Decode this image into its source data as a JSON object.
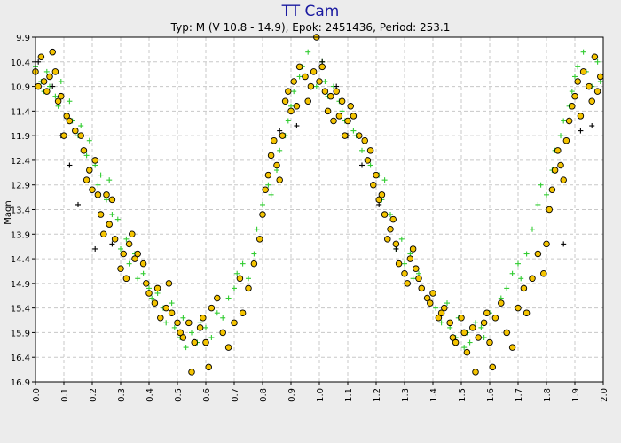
{
  "chart_data": {
    "type": "scatter",
    "title": "TT Cam",
    "subtitle": "Typ: M (V 10.8 - 14.9), Epok: 2451436, Period: 253.1",
    "xlabel": "",
    "ylabel": "Magn",
    "xlim": [
      0.0,
      2.0
    ],
    "ylim": [
      9.9,
      16.9
    ],
    "y_inverted": true,
    "x_ticks": [
      "0.0",
      "0.1",
      "0.2",
      "0.3",
      "0.4",
      "0.5",
      "0.6",
      "0.7",
      "0.8",
      "0.9",
      "1.0",
      "1.1",
      "1.2",
      "1.3",
      "1.4",
      "1.5",
      "1.6",
      "1.7",
      "1.8",
      "1.9",
      "2.0"
    ],
    "y_ticks": [
      "9.9",
      "10.4",
      "10.9",
      "11.4",
      "11.9",
      "12.4",
      "12.9",
      "13.4",
      "13.9",
      "14.4",
      "14.9",
      "15.4",
      "15.9",
      "16.4",
      "16.9"
    ],
    "grid": true,
    "legend": "none",
    "series": [
      {
        "marker": "circle",
        "color": "#f5c400",
        "x": [
          0.0,
          0.01,
          0.02,
          0.03,
          0.04,
          0.05,
          0.06,
          0.07,
          0.08,
          0.09,
          0.1,
          0.11,
          0.12,
          0.14,
          0.16,
          0.17,
          0.18,
          0.19,
          0.2,
          0.21,
          0.22,
          0.23,
          0.24,
          0.25,
          0.26,
          0.27,
          0.28,
          0.3,
          0.31,
          0.32,
          0.33,
          0.34,
          0.35,
          0.36,
          0.38,
          0.39,
          0.4,
          0.42,
          0.43,
          0.44,
          0.46,
          0.47,
          0.48,
          0.5,
          0.51,
          0.52,
          0.54,
          0.55,
          0.56,
          0.58,
          0.59,
          0.6,
          0.61,
          0.62,
          0.64,
          0.66,
          0.68,
          0.7,
          0.72,
          0.73,
          0.75,
          0.77,
          0.79,
          0.8,
          0.81,
          0.82,
          0.83,
          0.84,
          0.85,
          0.86,
          0.87,
          0.88,
          0.89,
          0.9,
          0.91,
          0.92,
          0.93,
          0.95,
          0.96,
          0.97,
          0.98,
          0.99,
          1.0,
          1.01,
          1.02,
          1.03,
          1.04,
          1.05,
          1.06,
          1.07,
          1.08,
          1.09,
          1.1,
          1.11,
          1.12,
          1.14,
          1.16,
          1.17,
          1.18,
          1.19,
          1.2,
          1.21,
          1.22,
          1.23,
          1.24,
          1.25,
          1.26,
          1.27,
          1.28,
          1.3,
          1.31,
          1.32,
          1.33,
          1.34,
          1.35,
          1.36,
          1.38,
          1.39,
          1.4,
          1.42,
          1.43,
          1.44,
          1.46,
          1.47,
          1.48,
          1.5,
          1.51,
          1.52,
          1.54,
          1.55,
          1.56,
          1.58,
          1.59,
          1.6,
          1.61,
          1.62,
          1.64,
          1.66,
          1.68,
          1.7,
          1.72,
          1.73,
          1.75,
          1.77,
          1.79,
          1.8,
          1.81,
          1.82,
          1.83,
          1.84,
          1.85,
          1.86,
          1.87,
          1.88,
          1.89,
          1.9,
          1.91,
          1.92,
          1.93,
          1.95,
          1.96,
          1.97,
          1.98,
          1.99
        ],
        "y": [
          10.6,
          10.9,
          10.3,
          10.8,
          11.0,
          10.7,
          10.2,
          10.6,
          11.2,
          11.1,
          11.9,
          11.5,
          11.6,
          11.8,
          11.9,
          12.2,
          12.8,
          12.6,
          13.0,
          12.4,
          13.1,
          13.5,
          13.9,
          13.1,
          13.7,
          13.2,
          14.0,
          14.6,
          14.3,
          14.8,
          14.1,
          13.9,
          14.4,
          14.3,
          14.5,
          14.9,
          15.1,
          15.3,
          15.0,
          15.6,
          15.4,
          14.9,
          15.5,
          15.7,
          15.9,
          16.0,
          15.7,
          16.7,
          16.1,
          15.8,
          15.6,
          16.1,
          16.6,
          15.4,
          15.2,
          15.9,
          16.2,
          15.7,
          14.8,
          15.5,
          15.0,
          14.5,
          14.0,
          13.5,
          13.0,
          12.7,
          12.3,
          12.0,
          12.5,
          12.8,
          11.9,
          11.2,
          11.0,
          11.4,
          10.8,
          11.3,
          10.5,
          10.7,
          11.2,
          10.9,
          10.6,
          9.9,
          10.8,
          10.5,
          11.0,
          11.4,
          11.1,
          11.6,
          11.0,
          11.5,
          11.2,
          11.9,
          11.6,
          11.3,
          11.5,
          11.9,
          12.0,
          12.4,
          12.2,
          12.9,
          12.7,
          13.2,
          13.1,
          13.5,
          14.0,
          13.8,
          13.6,
          14.1,
          14.5,
          14.7,
          14.9,
          14.4,
          14.2,
          14.6,
          14.8,
          15.0,
          15.2,
          15.3,
          15.1,
          15.6,
          15.5,
          15.4,
          15.7,
          16.0,
          16.1,
          15.6,
          15.9,
          16.3,
          15.8,
          16.7,
          16.0,
          15.7,
          15.5,
          16.1,
          16.6,
          15.6,
          15.3,
          15.9,
          16.2,
          15.4,
          15.0,
          15.5,
          14.8,
          14.3,
          14.7,
          14.1,
          13.4,
          13.0,
          12.6,
          12.2,
          12.5,
          12.8,
          12.0,
          11.6,
          11.3,
          11.1,
          10.8,
          11.5,
          10.6,
          10.9,
          11.2,
          10.3,
          11.0,
          10.7
        ]
      },
      {
        "marker": "plus",
        "color": "#33cc33",
        "x": [
          0.0,
          0.02,
          0.03,
          0.04,
          0.05,
          0.07,
          0.08,
          0.09,
          0.11,
          0.12,
          0.13,
          0.15,
          0.16,
          0.18,
          0.19,
          0.21,
          0.22,
          0.23,
          0.25,
          0.26,
          0.27,
          0.29,
          0.3,
          0.32,
          0.33,
          0.35,
          0.36,
          0.38,
          0.4,
          0.41,
          0.43,
          0.45,
          0.46,
          0.48,
          0.49,
          0.51,
          0.52,
          0.53,
          0.55,
          0.57,
          0.58,
          0.6,
          0.62,
          0.64,
          0.66,
          0.68,
          0.7,
          0.71,
          0.73,
          0.75,
          0.77,
          0.78,
          0.8,
          0.82,
          0.83,
          0.85,
          0.86,
          0.88,
          0.89,
          0.9,
          0.91,
          0.93,
          0.94,
          0.96,
          0.98,
          0.99,
          1.01,
          1.02,
          1.03,
          1.05,
          1.07,
          1.08,
          1.09,
          1.11,
          1.12,
          1.13,
          1.15,
          1.16,
          1.18,
          1.19,
          1.21,
          1.22,
          1.23,
          1.25,
          1.26,
          1.27,
          1.29,
          1.3,
          1.32,
          1.33,
          1.35,
          1.36,
          1.38,
          1.4,
          1.41,
          1.43,
          1.45,
          1.46,
          1.48,
          1.49,
          1.51,
          1.52,
          1.53,
          1.55,
          1.57,
          1.58,
          1.6,
          1.62,
          1.64,
          1.66,
          1.68,
          1.7,
          1.71,
          1.73,
          1.75,
          1.77,
          1.78,
          1.8,
          1.82,
          1.83,
          1.85,
          1.86,
          1.88,
          1.89,
          1.9,
          1.91,
          1.93,
          1.94,
          1.96,
          1.98,
          1.99
        ],
        "y": [
          10.5,
          10.8,
          11.0,
          10.6,
          10.9,
          11.1,
          11.3,
          10.8,
          11.5,
          11.2,
          11.6,
          11.9,
          11.7,
          12.3,
          12.0,
          12.5,
          12.9,
          12.7,
          13.2,
          12.8,
          13.5,
          13.6,
          14.2,
          14.0,
          14.5,
          14.3,
          14.8,
          14.7,
          15.0,
          15.2,
          15.1,
          15.4,
          15.7,
          15.3,
          15.8,
          16.0,
          15.6,
          16.2,
          15.9,
          16.1,
          15.7,
          15.8,
          16.0,
          15.5,
          15.6,
          15.2,
          15.0,
          14.7,
          14.5,
          14.8,
          14.3,
          13.8,
          13.3,
          12.9,
          13.1,
          12.6,
          12.2,
          11.9,
          11.6,
          11.3,
          11.0,
          10.7,
          10.5,
          10.2,
          10.6,
          10.9,
          10.4,
          10.8,
          11.1,
          10.9,
          11.2,
          11.4,
          11.6,
          11.3,
          11.8,
          11.9,
          12.2,
          12.0,
          12.5,
          12.9,
          12.7,
          13.2,
          12.8,
          13.5,
          13.6,
          14.2,
          14.0,
          14.5,
          14.3,
          14.8,
          14.7,
          15.0,
          15.2,
          15.1,
          15.4,
          15.7,
          15.3,
          15.8,
          16.0,
          15.6,
          16.2,
          15.9,
          16.1,
          15.7,
          15.8,
          16.0,
          15.5,
          15.6,
          15.2,
          15.0,
          14.7,
          14.5,
          14.8,
          14.3,
          13.8,
          13.3,
          12.9,
          13.1,
          12.6,
          12.2,
          11.9,
          11.6,
          11.3,
          11.0,
          10.7,
          10.5,
          10.2,
          10.6,
          10.9,
          10.4,
          10.8
        ]
      },
      {
        "marker": "plus",
        "color": "#000000",
        "x": [
          0.01,
          0.06,
          0.09,
          0.12,
          0.15,
          0.21,
          0.27,
          0.86,
          0.92,
          0.96,
          1.01,
          1.06,
          1.1,
          1.15,
          1.21,
          1.27,
          1.86,
          1.92,
          1.96
        ],
        "y": [
          10.4,
          10.9,
          11.9,
          12.5,
          13.3,
          14.2,
          14.1,
          11.8,
          11.7,
          11.2,
          10.4,
          10.9,
          11.9,
          12.5,
          13.3,
          14.2,
          14.1,
          11.8,
          11.7
        ]
      }
    ]
  }
}
